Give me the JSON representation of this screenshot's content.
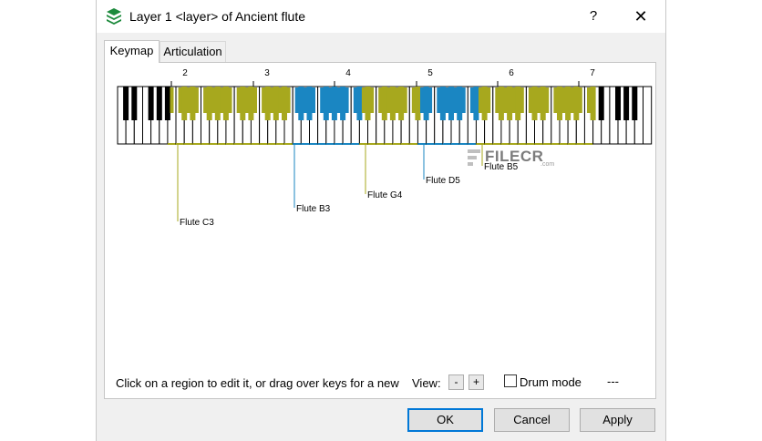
{
  "window": {
    "title": "Layer 1 <layer> of Ancient flute",
    "help_label": "?",
    "close_label": "✕"
  },
  "tabs": [
    {
      "label": "Keymap",
      "active": true
    },
    {
      "label": "Articulation",
      "active": false
    }
  ],
  "keyboard": {
    "octave_labels": [
      "2",
      "3",
      "4",
      "5",
      "6",
      "7"
    ],
    "colors": {
      "olive": "#a7a81e",
      "blue": "#1a86c2",
      "black": "#000000",
      "white": "#ffffff"
    },
    "regions": [
      {
        "label": "Flute C3",
        "color": "#a7a81e"
      },
      {
        "label": "Flute B3",
        "color": "#1a86c2"
      },
      {
        "label": "Flute G4",
        "color": "#a7a81e"
      },
      {
        "label": "Flute D5",
        "color": "#1a86c2"
      },
      {
        "label": "Flute B5",
        "color": "#a7a81e"
      }
    ]
  },
  "status": {
    "hint": "Click on a region to edit it, or drag over keys for a new",
    "view_label": "View:",
    "zoom_out_label": "-",
    "zoom_in_label": "+",
    "drum_mode_label": "Drum mode",
    "drum_mode_checked": false,
    "extra": "---"
  },
  "buttons": {
    "ok": "OK",
    "cancel": "Cancel",
    "apply": "Apply"
  },
  "watermark": {
    "text": "FILECR",
    "suffix": ".com"
  }
}
